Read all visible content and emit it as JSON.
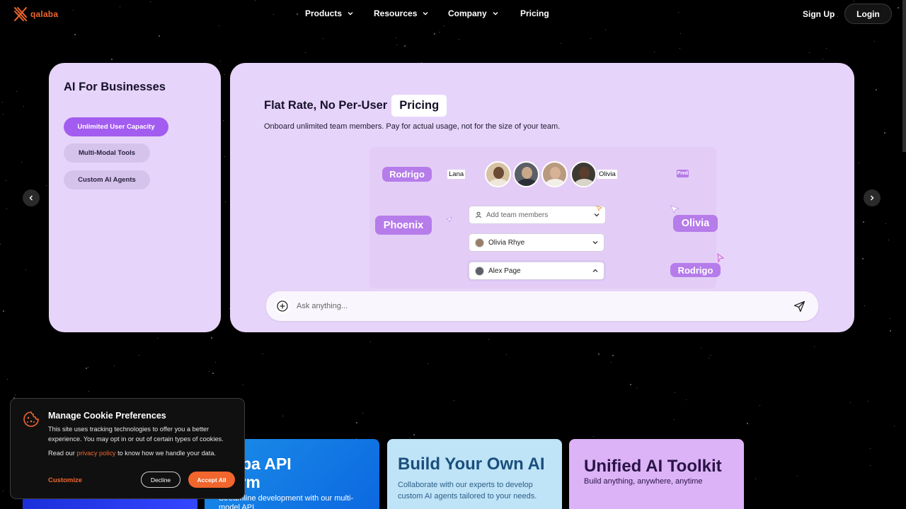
{
  "nav": {
    "logo_text": "qalaba",
    "items": [
      {
        "label": "Products"
      },
      {
        "label": "Resources"
      },
      {
        "label": "Company"
      },
      {
        "label": "Pricing"
      }
    ],
    "signup_label": "Sign Up",
    "login_label": "Login"
  },
  "hero": {
    "left_title": "AI For Businesses",
    "pills": [
      {
        "label": "Unlimited User Capacity",
        "active": true
      },
      {
        "label": "Multi-Modal Tools",
        "active": false
      },
      {
        "label": "Custom AI Agents",
        "active": false
      }
    ],
    "title_main": "Flat Rate, No Per-User",
    "title_highlight": "Pricing",
    "subtitle": "Onboard unlimited team members. Pay for actual usage, not for the size of your team.",
    "illustration": {
      "tags": [
        "Rodrigo",
        "Phoenix",
        "Olivia",
        "Rodrigo",
        "Fred"
      ],
      "small_names": [
        "Lana",
        "Olivia"
      ],
      "fields": {
        "add_placeholder": "Add team members",
        "member1": "Olivia Rhye",
        "member2": "Alex Page"
      }
    },
    "ask_placeholder": "Ask anything..."
  },
  "cards": [
    {
      "title": "alaba API\ntform",
      "desc": "Streamline development with our multi-model API"
    },
    {
      "title": "Build Your Own AI",
      "desc": "Collaborate with our experts to develop custom AI agents tailored to your needs."
    },
    {
      "title": "Unified AI Toolkit",
      "desc": "Build anything, anywhere, anytime"
    }
  ],
  "cookie": {
    "title": "Manage Cookie Preferences",
    "text": "This site uses tracking technologies to offer you a better experience. You may opt in or out of certain types of cookies.",
    "policy_prefix": "Read our",
    "policy_link": "privacy policy",
    "policy_suffix": "to know how we handle your data.",
    "customize_label": "Customize",
    "decline_label": "Decline",
    "accept_label": "Accept All"
  },
  "colors": {
    "brand": "#f0662c",
    "accent": "#a35cf0",
    "card_bg": "#e7d4fa"
  }
}
